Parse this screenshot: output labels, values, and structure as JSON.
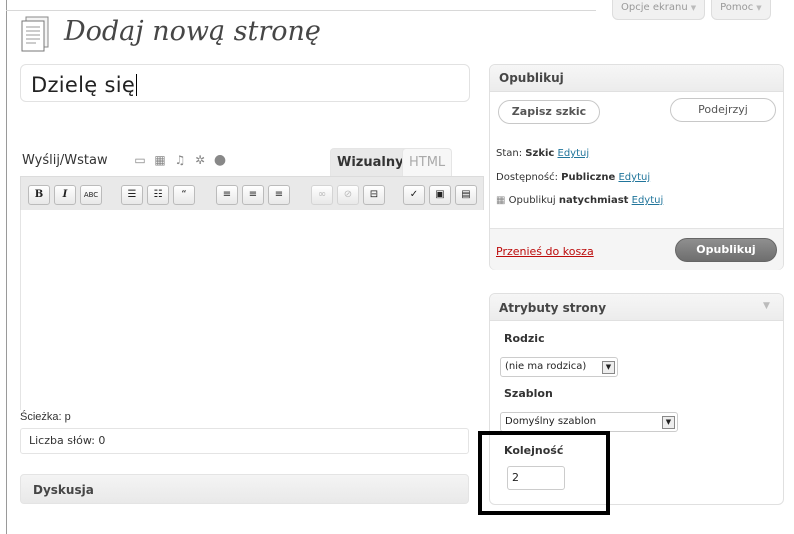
{
  "screen_tabs": {
    "options_label": "Opcje ekranu",
    "help_label": "Pomoc"
  },
  "page": {
    "title": "Dodaj nową stronę"
  },
  "editor": {
    "post_title": "Dzielę się",
    "upload_label": "Wyślij/Wstaw",
    "tab_visual": "Wizualny",
    "tab_html": "HTML",
    "path_label": "Ścieżka: p",
    "word_count": "Liczba słów: 0"
  },
  "discussion": {
    "title": "Dyskusja"
  },
  "publish": {
    "title": "Opublikuj",
    "save_draft": "Zapisz szkic",
    "preview": "Podejrzyj",
    "status_label": "Stan:",
    "status_value": "Szkic",
    "visibility_label": "Dostępność:",
    "visibility_value": "Publiczne",
    "edit": "Edytuj",
    "publish_label": "Opublikuj",
    "publish_when": "natychmiast",
    "trash": "Przenieś do kosza",
    "publish_button": "Opublikuj"
  },
  "attributes": {
    "title": "Atrybuty strony",
    "parent_label": "Rodzic",
    "parent_value": "(nie ma rodzica)",
    "template_label": "Szablon",
    "template_value": "Domyślny szablon",
    "order_label": "Kolejność",
    "order_value": "2"
  },
  "toolbar_buttons": [
    "B",
    "I",
    "ABC"
  ]
}
